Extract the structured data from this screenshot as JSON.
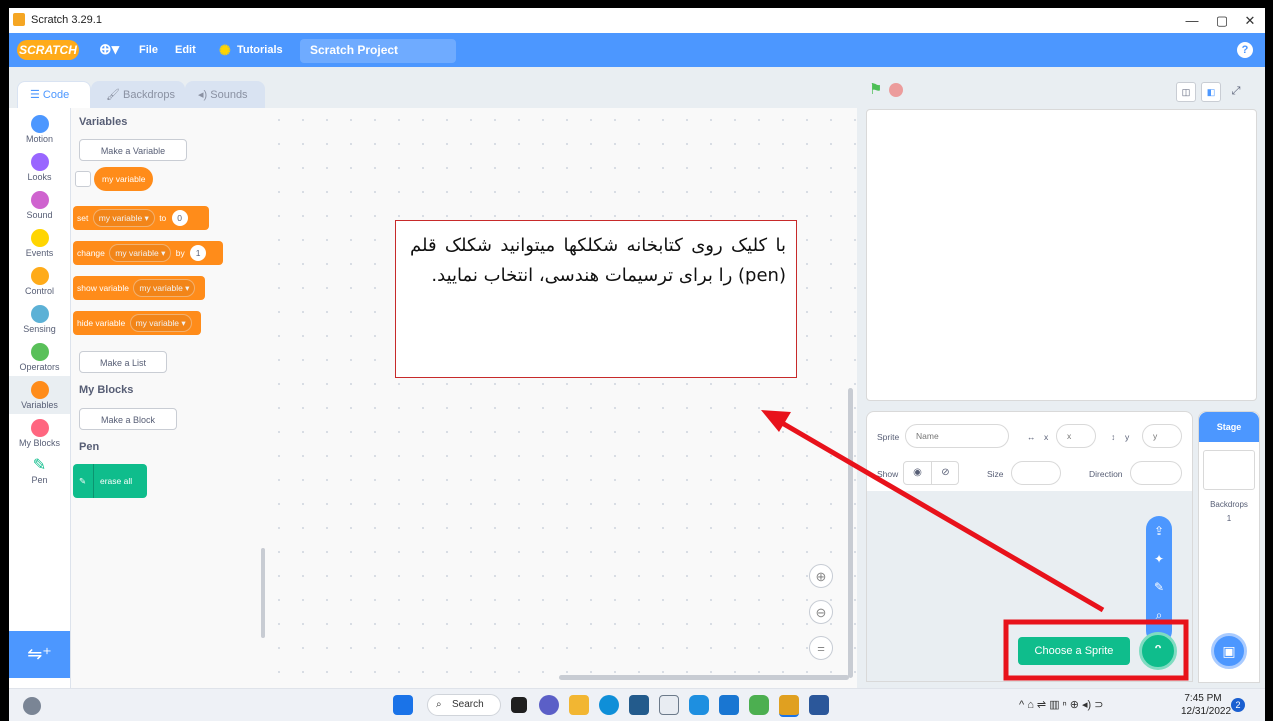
{
  "window": {
    "title": "Scratch 3.29.1",
    "controls": {
      "minimize": "—",
      "maximize": "▢",
      "close": "✕"
    }
  },
  "menubar": {
    "logo": "SCRATCH",
    "language_icon": "globe-icon",
    "items": [
      "File",
      "Edit",
      "Tutorials"
    ],
    "project_title": "Scratch Project",
    "help": "?"
  },
  "tabs": [
    "Code",
    "Backdrops",
    "Sounds"
  ],
  "categories": [
    {
      "label": "Motion",
      "color": "#4c97ff"
    },
    {
      "label": "Looks",
      "color": "#9966ff"
    },
    {
      "label": "Sound",
      "color": "#cf63cf"
    },
    {
      "label": "Events",
      "color": "#ffd500"
    },
    {
      "label": "Control",
      "color": "#ffab19"
    },
    {
      "label": "Sensing",
      "color": "#5cb1d6"
    },
    {
      "label": "Operators",
      "color": "#59c059"
    },
    {
      "label": "Variables",
      "color": "#ff8c1a"
    },
    {
      "label": "My Blocks",
      "color": "#ff6680"
    },
    {
      "label": "Pen",
      "color": "#0fbd8c"
    }
  ],
  "palette": {
    "variables_header": "Variables",
    "make_variable": "Make a Variable",
    "my_variable": "my variable",
    "set_block": {
      "verb": "set",
      "var": "my variable ▾",
      "to": "to",
      "value": "0"
    },
    "change_block": {
      "verb": "change",
      "var": "my variable ▾",
      "by": "by",
      "value": "1"
    },
    "show_block": {
      "verb": "show variable",
      "var": "my variable ▾"
    },
    "hide_block": {
      "verb": "hide variable",
      "var": "my variable ▾"
    },
    "make_list": "Make a List",
    "myblocks_header": "My Blocks",
    "make_block": "Make a Block",
    "pen_header": "Pen",
    "erase_all": "erase all"
  },
  "zoom": {
    "in": "⊕",
    "out": "⊖",
    "reset": "="
  },
  "note": "با کلیک روی کتابخانه شکلکها میتوانید شکلک قلم (pen) را برای ترسیمات هندسی، انتخاب نمایید.",
  "sprite_info": {
    "sprite_label": "Sprite",
    "name_placeholder": "Name",
    "x_label": "x",
    "x_placeholder": "x",
    "y_label": "y",
    "y_placeholder": "y",
    "show_label": "Show",
    "size_label": "Size",
    "direction_label": "Direction"
  },
  "stage_panel": {
    "title": "Stage",
    "backdrops_label": "Backdrops",
    "backdrops_count": "1"
  },
  "choose_sprite": "Choose a Sprite",
  "taskbar": {
    "search": "Search",
    "time": "7:45 PM",
    "date": "12/31/2022",
    "notifications": "2"
  },
  "colors": {
    "scratch_blue": "#4c97ff",
    "variables_orange": "#ff8c1a",
    "pen_green": "#0fbd8c",
    "annotation_red": "#e8121b"
  }
}
